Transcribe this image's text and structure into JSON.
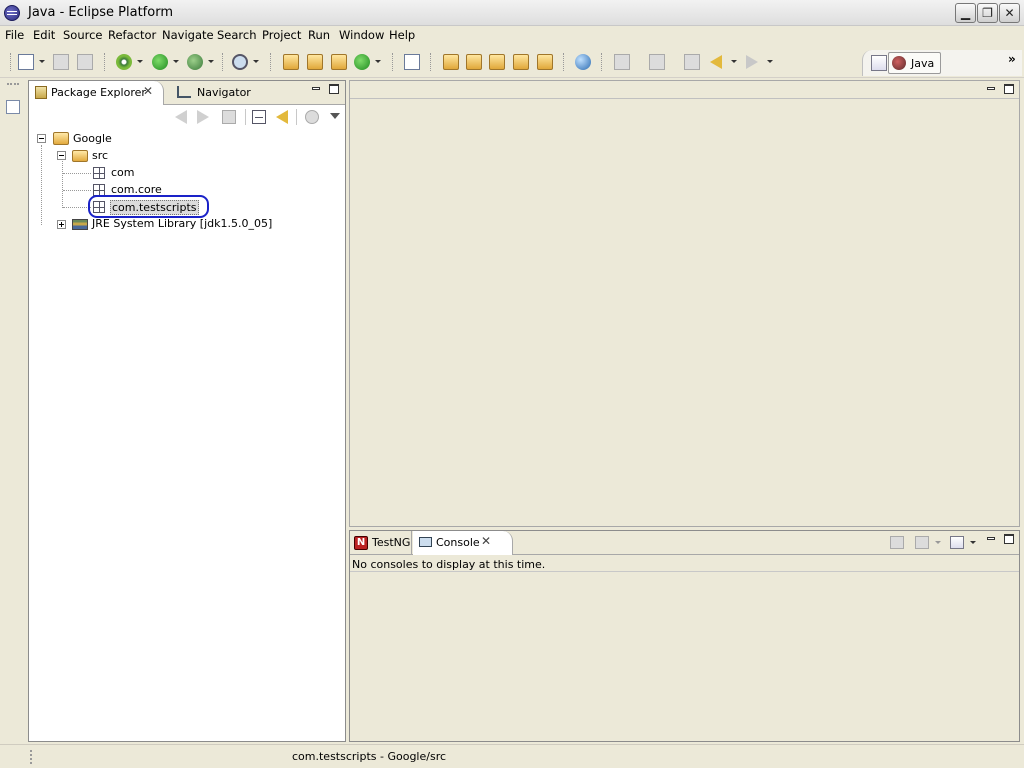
{
  "window": {
    "title": "Java - Eclipse Platform"
  },
  "menu": [
    "File",
    "Edit",
    "Source",
    "Refactor",
    "Navigate",
    "Search",
    "Project",
    "Run",
    "Window",
    "Help"
  ],
  "perspective": {
    "label": "Java",
    "chevron": "»"
  },
  "package_explorer": {
    "tab_label": "Package Explorer",
    "navigator_label": "Navigator",
    "tree": {
      "project": "Google",
      "src": "src",
      "packages": [
        "com",
        "com.core",
        "com.testscripts"
      ],
      "library": "JRE System Library [jdk1.5.0_05]"
    }
  },
  "console": {
    "testng_label": "TestNG",
    "console_label": "Console",
    "message": "No consoles to display at this time."
  },
  "statusbar": {
    "text": "com.testscripts - Google/src"
  },
  "colors": {
    "selection_ring": "#1a22c8",
    "chrome": "#ece9d8"
  }
}
